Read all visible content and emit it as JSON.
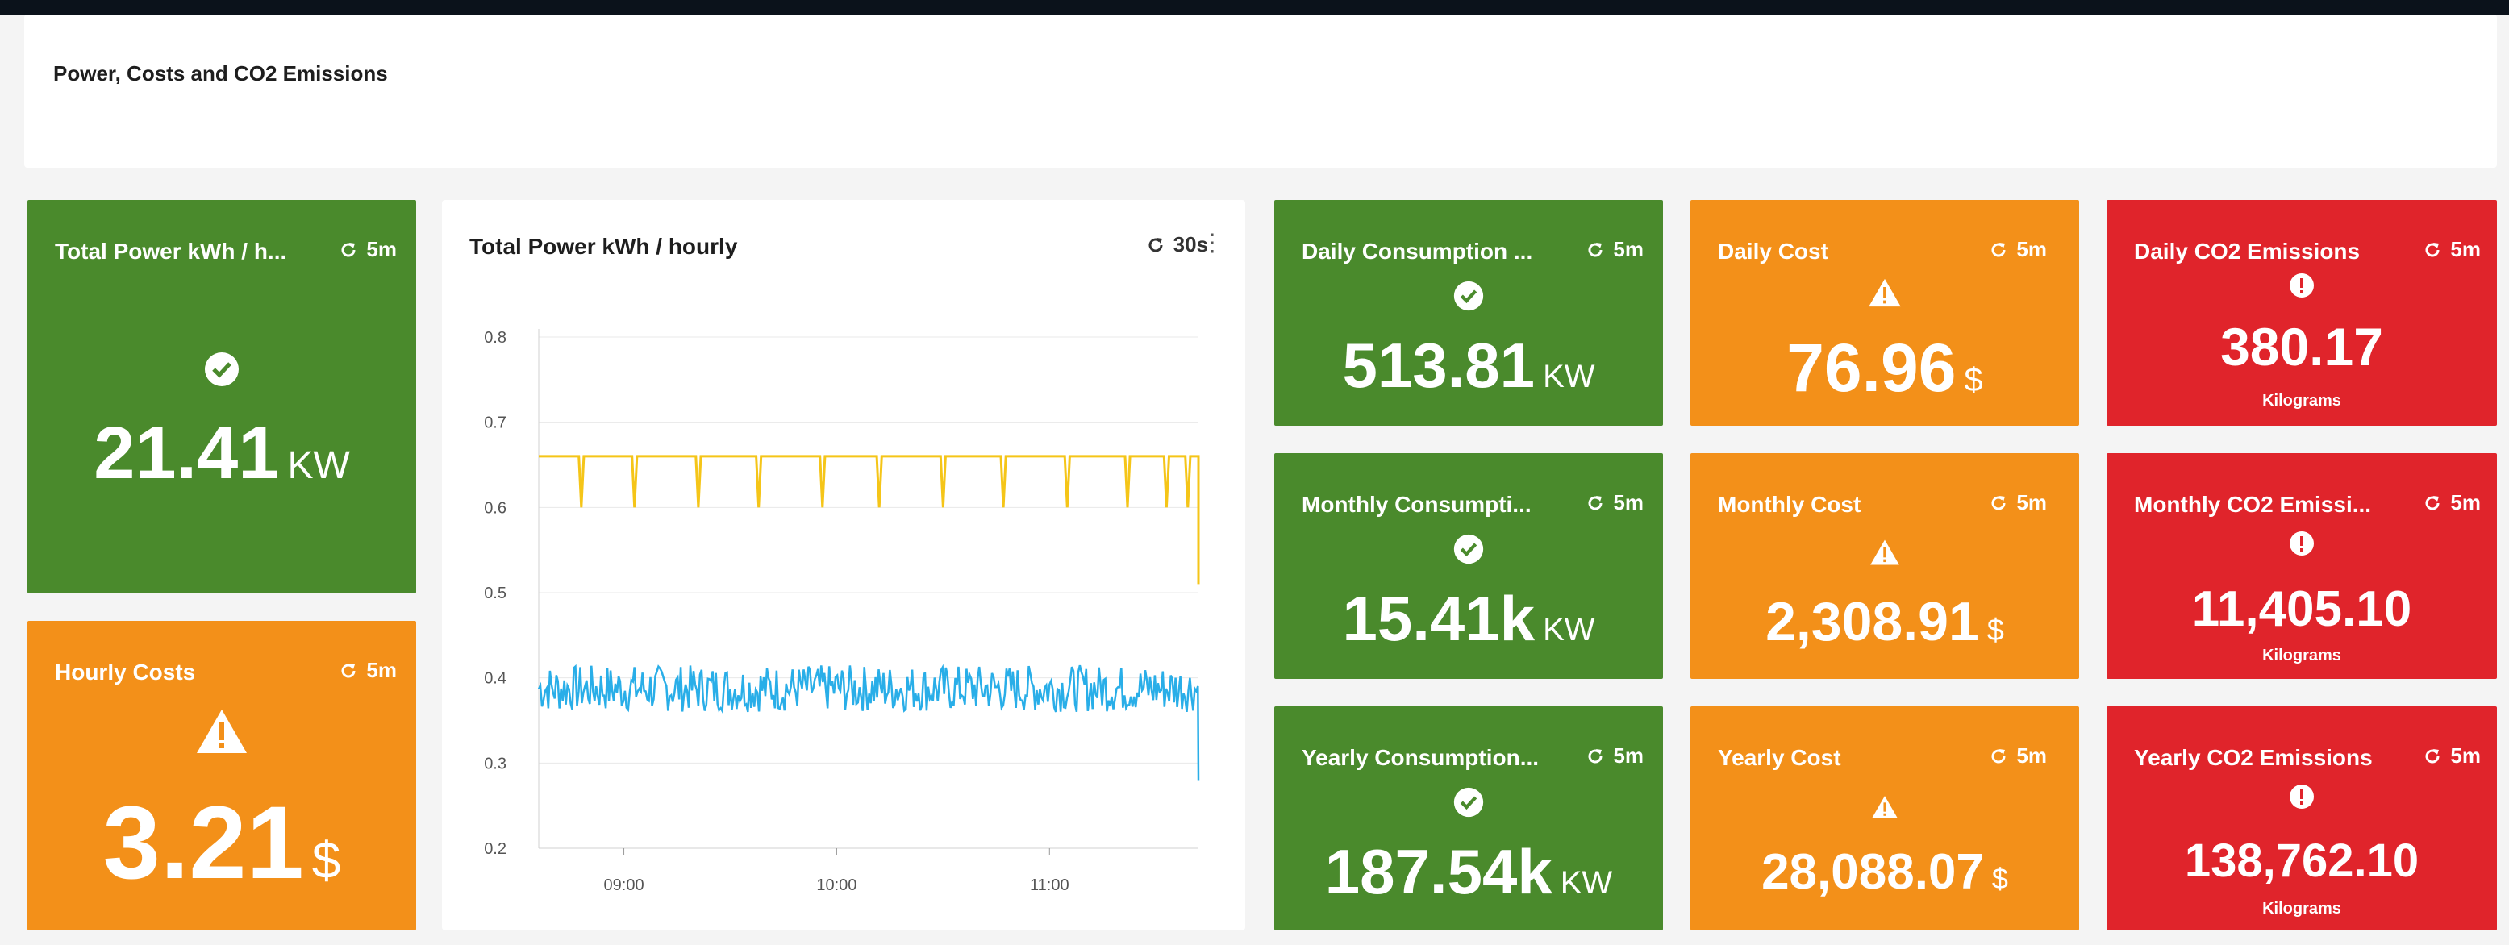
{
  "header": {
    "title": "Power, Costs and CO2 Emissions"
  },
  "tiles": {
    "total_power": {
      "title": "Total Power kWh / h...",
      "refresh": "5m",
      "value": "21.41",
      "unit": "KW",
      "icon": "check-circle-icon"
    },
    "hourly_costs": {
      "title": "Hourly Costs",
      "refresh": "5m",
      "value": "3.21",
      "unit": "$",
      "icon": "warning-triangle-icon"
    },
    "daily_consumption": {
      "title": "Daily Consumption ...",
      "refresh": "5m",
      "value": "513.81",
      "unit": "KW",
      "icon": "check-circle-icon"
    },
    "monthly_consumption": {
      "title": "Monthly Consumpti...",
      "refresh": "5m",
      "value": "15.41k",
      "unit": "KW",
      "icon": "check-circle-icon"
    },
    "yearly_consumption": {
      "title": "Yearly Consumption...",
      "refresh": "5m",
      "value": "187.54k",
      "unit": "KW",
      "icon": "check-circle-icon"
    },
    "daily_cost": {
      "title": "Daily Cost",
      "refresh": "5m",
      "value": "76.96",
      "unit": "$",
      "icon": "warning-triangle-icon"
    },
    "monthly_cost": {
      "title": "Monthly Cost",
      "refresh": "5m",
      "value": "2,308.91",
      "unit": "$",
      "icon": "warning-triangle-icon"
    },
    "yearly_cost": {
      "title": "Yearly Cost",
      "refresh": "5m",
      "value": "28,088.07",
      "unit": "$",
      "icon": "warning-triangle-icon"
    },
    "daily_co2": {
      "title": "Daily CO2 Emissions",
      "refresh": "5m",
      "value": "380.17",
      "sub": "Kilograms",
      "icon": "exclamation-circle-icon"
    },
    "monthly_co2": {
      "title": "Monthly CO2 Emissi...",
      "refresh": "5m",
      "value": "11,405.10",
      "sub": "Kilograms",
      "icon": "exclamation-circle-icon"
    },
    "yearly_co2": {
      "title": "Yearly CO2 Emissions",
      "refresh": "5m",
      "value": "138,762.10",
      "sub": "Kilograms",
      "icon": "exclamation-circle-icon"
    }
  },
  "colors": {
    "green": "#4a8a2c",
    "orange": "#f39019",
    "red": "#e0242b",
    "series_yellow": "#f5c518",
    "series_blue": "#29aee8"
  },
  "chart_panel": {
    "title": "Total Power kWh / hourly",
    "refresh": "30s",
    "menu_icon": "kebab-menu-icon"
  },
  "chart_data": {
    "type": "line",
    "title": "Total Power kWh / hourly",
    "xlabel": "",
    "ylabel": "",
    "x_ticks": [
      "09:00",
      "10:00",
      "11:00"
    ],
    "y_ticks": [
      "0.8",
      "0.7",
      "0.6",
      "0.5",
      "0.4",
      "0.3",
      "0.2"
    ],
    "ylim": [
      0.2,
      0.8
    ],
    "x_range": [
      "08:36",
      "11:42"
    ],
    "grid": true,
    "series": [
      {
        "color": "#f5c518",
        "baseline": 0.66,
        "dips": [
          {
            "x": "08:48",
            "y": 0.6
          },
          {
            "x": "09:03",
            "y": 0.6
          },
          {
            "x": "09:21",
            "y": 0.6
          },
          {
            "x": "09:38",
            "y": 0.6
          },
          {
            "x": "09:56",
            "y": 0.6
          },
          {
            "x": "10:12",
            "y": 0.6
          },
          {
            "x": "10:30",
            "y": 0.6
          },
          {
            "x": "10:47",
            "y": 0.6
          },
          {
            "x": "11:05",
            "y": 0.6
          },
          {
            "x": "11:22",
            "y": 0.6
          },
          {
            "x": "11:33",
            "y": 0.6
          },
          {
            "x": "11:39",
            "y": 0.6
          },
          {
            "x": "11:42",
            "y": 0.51
          }
        ]
      },
      {
        "color": "#29aee8",
        "mean": 0.385,
        "range": [
          0.36,
          0.415
        ],
        "end_value": 0.28
      }
    ]
  }
}
